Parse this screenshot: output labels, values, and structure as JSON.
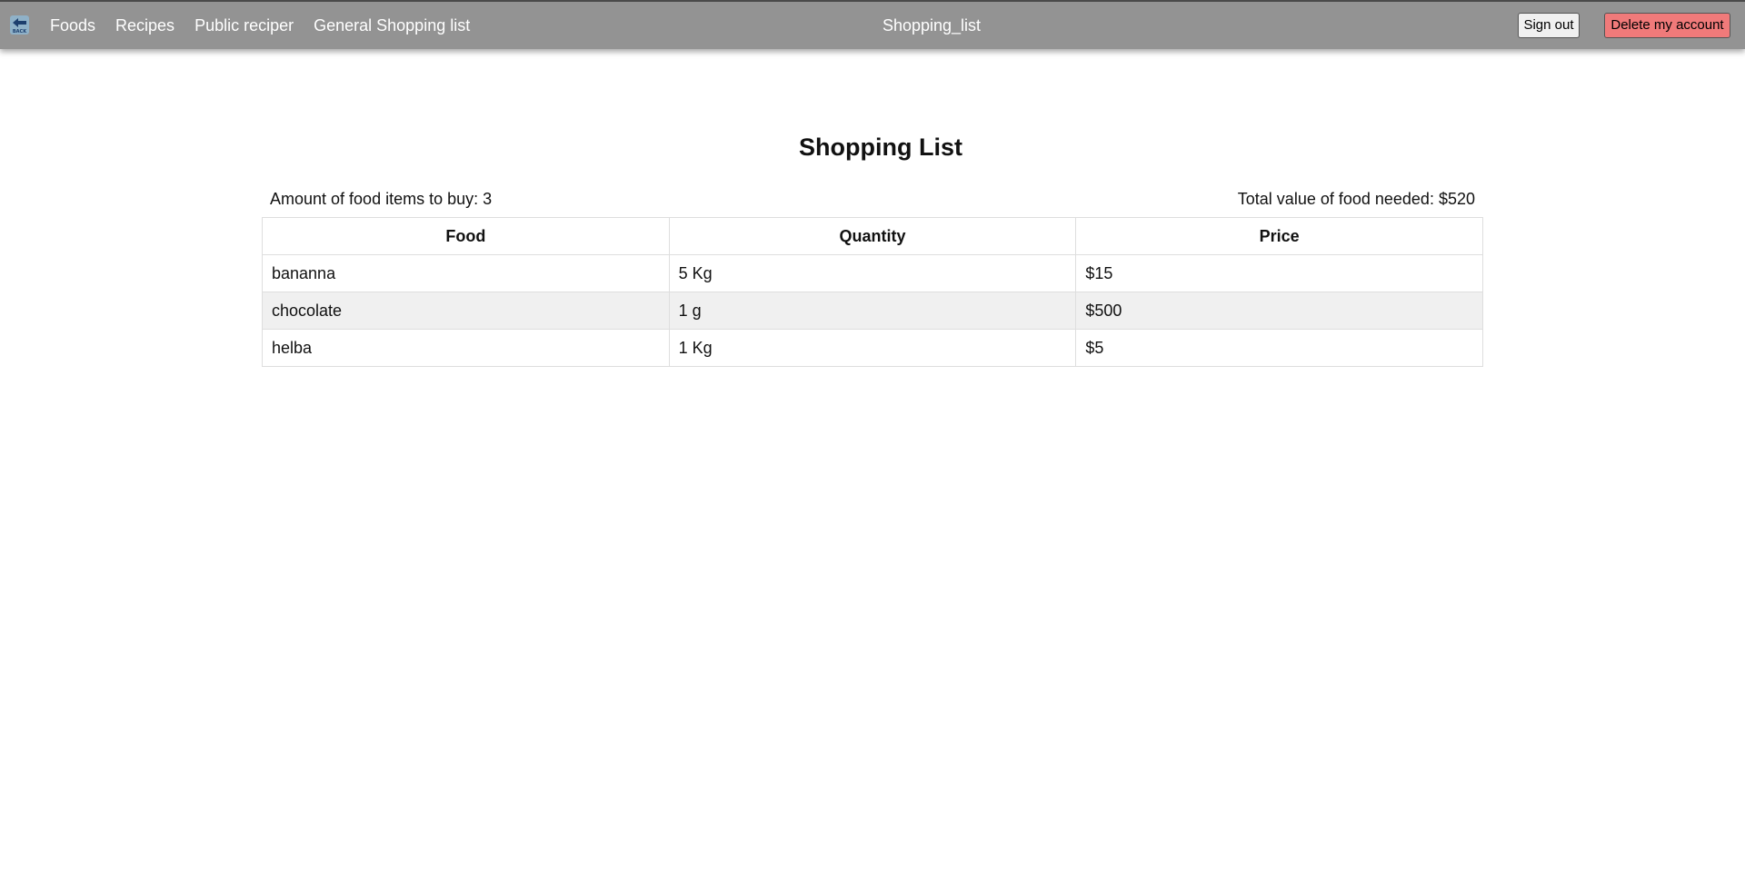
{
  "navbar": {
    "back_icon": "back-arrow-icon",
    "back_icon_label": "BACK",
    "links": [
      "Foods",
      "Recipes",
      "Public reciper",
      "General Shopping list"
    ],
    "title": "Shopping_list",
    "sign_out_label": "Sign out",
    "delete_account_label": "Delete my account",
    "delete_button_color": "#f07a7a",
    "bar_color": "#939393"
  },
  "main": {
    "heading": "Shopping List",
    "items_count_text": "Amount of food items to buy: 3",
    "total_value_text": "Total value of food needed: $520",
    "table": {
      "headers": [
        "Food",
        "Quantity",
        "Price"
      ],
      "rows": [
        [
          "bananna",
          "5 Kg",
          "$15"
        ],
        [
          "chocolate",
          "1 g",
          "$500"
        ],
        [
          "helba",
          "1 Kg",
          "$5"
        ]
      ]
    }
  }
}
